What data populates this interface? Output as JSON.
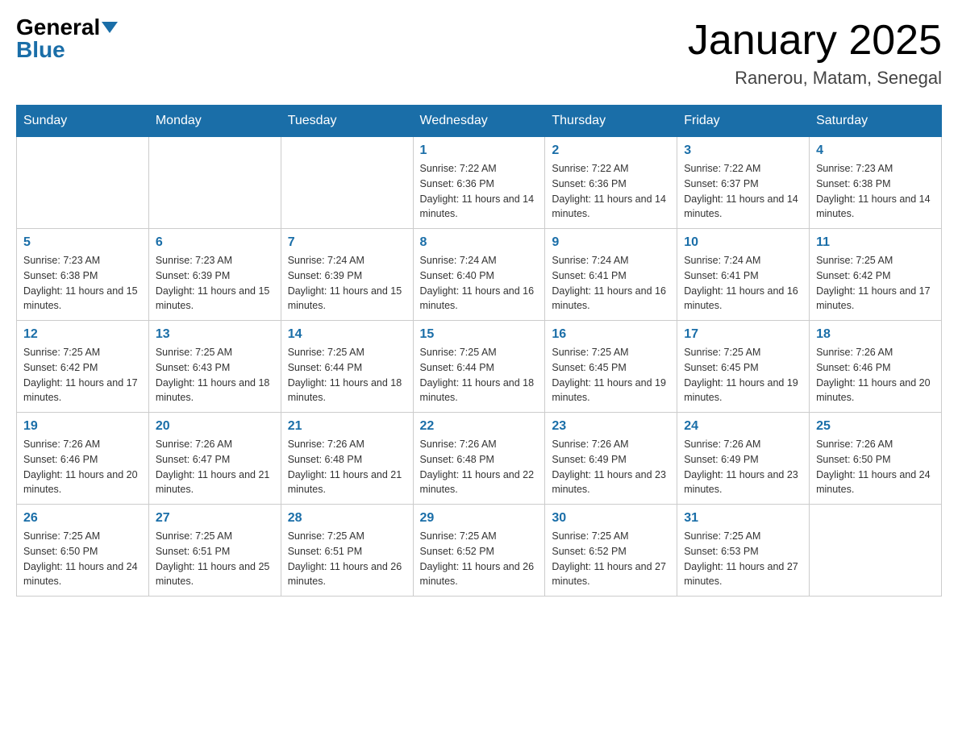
{
  "header": {
    "logo_general": "General",
    "logo_blue": "Blue",
    "month": "January 2025",
    "location": "Ranerou, Matam, Senegal"
  },
  "weekdays": [
    "Sunday",
    "Monday",
    "Tuesday",
    "Wednesday",
    "Thursday",
    "Friday",
    "Saturday"
  ],
  "weeks": [
    [
      {
        "day": "",
        "info": ""
      },
      {
        "day": "",
        "info": ""
      },
      {
        "day": "",
        "info": ""
      },
      {
        "day": "1",
        "info": "Sunrise: 7:22 AM\nSunset: 6:36 PM\nDaylight: 11 hours and 14 minutes."
      },
      {
        "day": "2",
        "info": "Sunrise: 7:22 AM\nSunset: 6:36 PM\nDaylight: 11 hours and 14 minutes."
      },
      {
        "day": "3",
        "info": "Sunrise: 7:22 AM\nSunset: 6:37 PM\nDaylight: 11 hours and 14 minutes."
      },
      {
        "day": "4",
        "info": "Sunrise: 7:23 AM\nSunset: 6:38 PM\nDaylight: 11 hours and 14 minutes."
      }
    ],
    [
      {
        "day": "5",
        "info": "Sunrise: 7:23 AM\nSunset: 6:38 PM\nDaylight: 11 hours and 15 minutes."
      },
      {
        "day": "6",
        "info": "Sunrise: 7:23 AM\nSunset: 6:39 PM\nDaylight: 11 hours and 15 minutes."
      },
      {
        "day": "7",
        "info": "Sunrise: 7:24 AM\nSunset: 6:39 PM\nDaylight: 11 hours and 15 minutes."
      },
      {
        "day": "8",
        "info": "Sunrise: 7:24 AM\nSunset: 6:40 PM\nDaylight: 11 hours and 16 minutes."
      },
      {
        "day": "9",
        "info": "Sunrise: 7:24 AM\nSunset: 6:41 PM\nDaylight: 11 hours and 16 minutes."
      },
      {
        "day": "10",
        "info": "Sunrise: 7:24 AM\nSunset: 6:41 PM\nDaylight: 11 hours and 16 minutes."
      },
      {
        "day": "11",
        "info": "Sunrise: 7:25 AM\nSunset: 6:42 PM\nDaylight: 11 hours and 17 minutes."
      }
    ],
    [
      {
        "day": "12",
        "info": "Sunrise: 7:25 AM\nSunset: 6:42 PM\nDaylight: 11 hours and 17 minutes."
      },
      {
        "day": "13",
        "info": "Sunrise: 7:25 AM\nSunset: 6:43 PM\nDaylight: 11 hours and 18 minutes."
      },
      {
        "day": "14",
        "info": "Sunrise: 7:25 AM\nSunset: 6:44 PM\nDaylight: 11 hours and 18 minutes."
      },
      {
        "day": "15",
        "info": "Sunrise: 7:25 AM\nSunset: 6:44 PM\nDaylight: 11 hours and 18 minutes."
      },
      {
        "day": "16",
        "info": "Sunrise: 7:25 AM\nSunset: 6:45 PM\nDaylight: 11 hours and 19 minutes."
      },
      {
        "day": "17",
        "info": "Sunrise: 7:25 AM\nSunset: 6:45 PM\nDaylight: 11 hours and 19 minutes."
      },
      {
        "day": "18",
        "info": "Sunrise: 7:26 AM\nSunset: 6:46 PM\nDaylight: 11 hours and 20 minutes."
      }
    ],
    [
      {
        "day": "19",
        "info": "Sunrise: 7:26 AM\nSunset: 6:46 PM\nDaylight: 11 hours and 20 minutes."
      },
      {
        "day": "20",
        "info": "Sunrise: 7:26 AM\nSunset: 6:47 PM\nDaylight: 11 hours and 21 minutes."
      },
      {
        "day": "21",
        "info": "Sunrise: 7:26 AM\nSunset: 6:48 PM\nDaylight: 11 hours and 21 minutes."
      },
      {
        "day": "22",
        "info": "Sunrise: 7:26 AM\nSunset: 6:48 PM\nDaylight: 11 hours and 22 minutes."
      },
      {
        "day": "23",
        "info": "Sunrise: 7:26 AM\nSunset: 6:49 PM\nDaylight: 11 hours and 23 minutes."
      },
      {
        "day": "24",
        "info": "Sunrise: 7:26 AM\nSunset: 6:49 PM\nDaylight: 11 hours and 23 minutes."
      },
      {
        "day": "25",
        "info": "Sunrise: 7:26 AM\nSunset: 6:50 PM\nDaylight: 11 hours and 24 minutes."
      }
    ],
    [
      {
        "day": "26",
        "info": "Sunrise: 7:25 AM\nSunset: 6:50 PM\nDaylight: 11 hours and 24 minutes."
      },
      {
        "day": "27",
        "info": "Sunrise: 7:25 AM\nSunset: 6:51 PM\nDaylight: 11 hours and 25 minutes."
      },
      {
        "day": "28",
        "info": "Sunrise: 7:25 AM\nSunset: 6:51 PM\nDaylight: 11 hours and 26 minutes."
      },
      {
        "day": "29",
        "info": "Sunrise: 7:25 AM\nSunset: 6:52 PM\nDaylight: 11 hours and 26 minutes."
      },
      {
        "day": "30",
        "info": "Sunrise: 7:25 AM\nSunset: 6:52 PM\nDaylight: 11 hours and 27 minutes."
      },
      {
        "day": "31",
        "info": "Sunrise: 7:25 AM\nSunset: 6:53 PM\nDaylight: 11 hours and 27 minutes."
      },
      {
        "day": "",
        "info": ""
      }
    ]
  ]
}
